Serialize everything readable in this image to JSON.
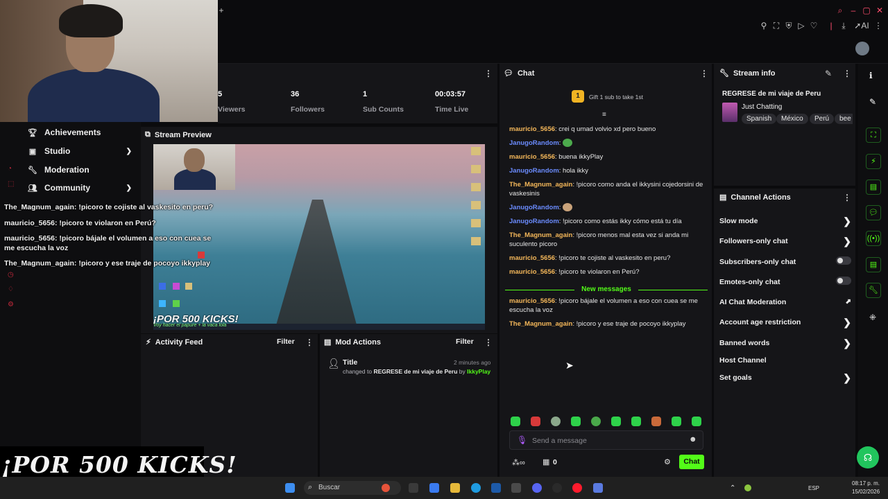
{
  "stats": [
    {
      "value": "5",
      "label": "Viewers"
    },
    {
      "value": "36",
      "label": "Followers"
    },
    {
      "value": "1",
      "label": "Sub Counts"
    },
    {
      "value": "00:03:57",
      "label": "Time Live"
    }
  ],
  "sidebar": {
    "items": [
      {
        "label": "Achievements",
        "icon": "trophy-icon"
      },
      {
        "label": "Studio",
        "icon": "studio-icon",
        "expand": true
      },
      {
        "label": "Moderation",
        "icon": "wrench-icon"
      },
      {
        "label": "Community",
        "icon": "community-icon",
        "expand": true
      }
    ]
  },
  "overlay_chat": [
    "The_Magnum_again: !picoro te cojiste al vaskesito en peru?",
    "mauricio_5656: !picoro te violaron en Perú?",
    "mauricio_5656: !picoro bájale el volumen a eso con cuea se",
    "me escucha la voz",
    "The_Magnum_again: !picoro y ese traje de pocoyo ikkyplay"
  ],
  "preview": {
    "title": "Stream Preview",
    "kicks": "¡POR 500 KICKS!",
    "kicks_sub": "Voy hacer el papure + la vaca lola"
  },
  "activity": {
    "title": "Activity Feed",
    "filter": "Filter"
  },
  "mod_actions": {
    "title": "Mod Actions",
    "filter": "Filter",
    "entry": {
      "title": "Title",
      "time": "2 minutes ago",
      "changed_prefix": "changed to",
      "value": "REGRESE de mi viaje de Peru",
      "by": "by",
      "user": "IkkyPlay"
    }
  },
  "chat": {
    "title": "Chat",
    "gift_count": "1",
    "gift_text": "Gift 1 sub to take 1st",
    "messages": [
      {
        "user": "mauricio_5656",
        "text": ": crei q umad volvio xd pero bueno",
        "color": "orange"
      },
      {
        "user": "JanugoRandom",
        "text": ":",
        "color": "blue",
        "emote": true
      },
      {
        "user": "mauricio_5656",
        "text": ": buena ikkyPlay",
        "color": "orange"
      },
      {
        "user": "JanugoRandom",
        "text": ": hola ikky",
        "color": "blue"
      },
      {
        "user": "The_Magnum_again",
        "text": ": !picoro como anda el ikkysini cojedorsini de vaskesinis",
        "color": "orange"
      },
      {
        "user": "JanugoRandom",
        "text": ":",
        "color": "blue",
        "emote": true
      },
      {
        "user": "JanugoRandom",
        "text": ": !picoro como estás ikky cómo está tu día",
        "color": "blue"
      },
      {
        "user": "The_Magnum_again",
        "text": ": !picoro menos mal esta vez si anda mi suculento picoro",
        "color": "orange"
      },
      {
        "user": "mauricio_5656",
        "text": ": !picoro te cojiste al vaskesito en peru?",
        "color": "orange"
      },
      {
        "user": "mauricio_5656",
        "text": ": !picoro te violaron en Perú?",
        "color": "orange"
      }
    ],
    "new_messages_label": "New messages",
    "new_messages": [
      {
        "user": "mauricio_5656",
        "text": ": !picoro bájale el volumen a eso con cuea se me escucha la voz",
        "color": "orange"
      },
      {
        "user": "The_Magnum_again",
        "text": ": !picoro y ese traje de pocoyo ikkyplay",
        "color": "orange"
      }
    ],
    "input_placeholder": "Send a message",
    "points": "0",
    "send_label": "Chat"
  },
  "stream_info": {
    "title": "Stream info",
    "stream_title": "REGRESE de mi viaje de Peru",
    "category": "Just Chatting",
    "tags": [
      "Spanish",
      "México",
      "Perú",
      "bee"
    ]
  },
  "channel_actions": {
    "title": "Channel Actions",
    "items": [
      {
        "label": "Slow mode",
        "control": "arrow"
      },
      {
        "label": "Followers-only chat",
        "control": "arrow"
      },
      {
        "label": "Subscribers-only chat",
        "control": "toggle"
      },
      {
        "label": "Emotes-only chat",
        "control": "toggle"
      },
      {
        "label": "AI Chat Moderation",
        "control": "external"
      },
      {
        "label": "Account age restriction",
        "control": "arrow"
      },
      {
        "label": "Banned words",
        "control": "arrow"
      },
      {
        "label": "Host Channel",
        "control": "none"
      },
      {
        "label": "Set goals",
        "control": "arrow"
      }
    ]
  },
  "taskbar": {
    "search_placeholder": "Buscar",
    "lang": "ESP",
    "time": "08:17 p. m.",
    "date": "15/02/2026"
  },
  "colors": {
    "accent": "#53fc18",
    "panel": "#151518",
    "orange_user": "#f5b85a",
    "blue_user": "#6b8cff"
  }
}
